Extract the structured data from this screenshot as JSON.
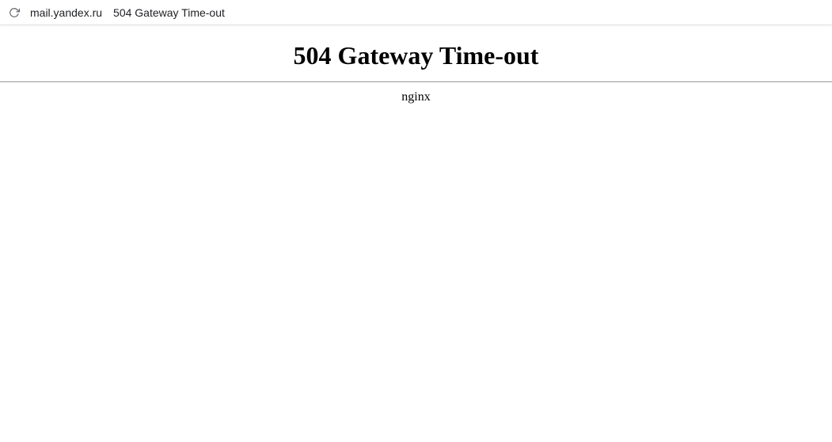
{
  "addressbar": {
    "url": "mail.yandex.ru",
    "tab_title": "504 Gateway Time-out"
  },
  "page": {
    "heading": "504 Gateway Time-out",
    "server": "nginx"
  }
}
